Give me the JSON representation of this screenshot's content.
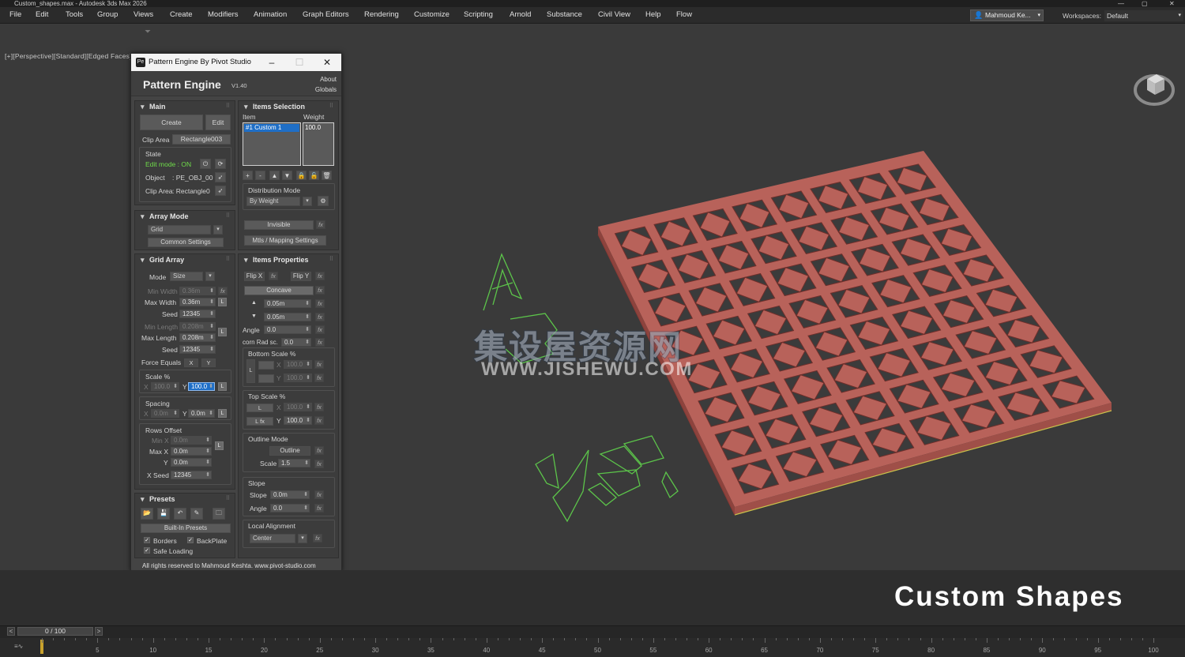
{
  "app": {
    "window_title": "Custom_shapes.max - Autodesk 3ds Max 2026",
    "menus": [
      "File",
      "Edit",
      "Tools",
      "Group",
      "Views",
      "Create",
      "Modifiers",
      "Animation",
      "Graph Editors",
      "Rendering",
      "Customize",
      "Scripting",
      "Arnold",
      "Substance",
      "Civil View",
      "Help",
      "Flow"
    ],
    "user": "Mahmoud Ke...",
    "workspaces_label": "Workspaces:",
    "workspace": "Default",
    "viewport_label": "[+][Perspective][Standard][Edged Faces]",
    "caption": "Custom Shapes",
    "watermark_cn": "集设屋资源网",
    "watermark_url": "WWW.JISHEWU.COM"
  },
  "timeline": {
    "slider": "0 / 100",
    "prev": "<",
    "next": ">",
    "ticks": [
      "5",
      "10",
      "15",
      "20",
      "25",
      "30",
      "35",
      "40",
      "45",
      "50",
      "55",
      "60",
      "65",
      "70",
      "75",
      "80",
      "85",
      "90",
      "95",
      "100"
    ]
  },
  "plugin": {
    "title": "Pattern Engine By Pivot Studio",
    "icon_text": "Pe",
    "name": "Pattern Engine",
    "version": "V1.40",
    "about": "About",
    "globals": "Globals",
    "footer": "All rights reserved to Mahmoud Keshta. www.pivot-studio.com",
    "main": {
      "header": "Main",
      "create": "Create",
      "edit": "Edit",
      "clip_area_label": "Clip Area",
      "clip_area_value": "Rectangle003",
      "state_label": "State",
      "edit_mode": "Edit mode : ON",
      "object_label": "Object",
      "object_value": ": PE_OBJ_00",
      "clip_area2_label": "Clip Area",
      "clip_area2_value": ": Rectangle0"
    },
    "array_mode": {
      "header": "Array Mode",
      "value": "Grid",
      "common_settings": "Common Settings"
    },
    "grid_array": {
      "header": "Grid Array",
      "mode_label": "Mode",
      "mode_value": "Size",
      "min_width_label": "Min Width",
      "min_width": "0.36m",
      "max_width_label": "Max Width",
      "max_width": "0.36m",
      "seed_label": "Seed",
      "seed1": "12345",
      "min_length_label": "Min Length",
      "min_length": "0.208m",
      "max_length_label": "Max Length",
      "max_length": "0.208m",
      "seed2": "12345",
      "force_equals_label": "Force Equals",
      "fx": "X",
      "fy": "Y",
      "scale_label": "Scale %",
      "scale_x_label": "X",
      "scale_x": "100.0",
      "scale_y_label": "Y",
      "scale_y": "100.0",
      "spacing_label": "Spacing",
      "spacing_x_label": "X",
      "spacing_x": "0.0m",
      "spacing_y_label": "Y",
      "spacing_y": "0.0m",
      "rows_offset_label": "Rows Offset",
      "min_x_label": "Min X",
      "min_x": "0.0m",
      "max_x_label": "Max X",
      "max_x": "0.0m",
      "y_label": "Y",
      "y_val": "0.0m",
      "x_seed_label": "X Seed",
      "x_seed": "12345",
      "lock": "L"
    },
    "presets": {
      "header": "Presets",
      "built_in": "Built-In Presets",
      "borders": "Borders",
      "backplate": "BackPlate",
      "safe_loading": "Safe Loading"
    },
    "items_selection": {
      "header": "Items Selection",
      "col_item": "Item",
      "col_weight": "Weight",
      "item1": "#1 Custom 1",
      "weight1": "100.0",
      "distribution_label": "Distribution Mode",
      "distribution_value": "By Weight",
      "invisible": "Invisible",
      "mtls": "Mtls / Mapping Settings"
    },
    "items_properties": {
      "header": "Items Properties",
      "flip_x": "Flip X",
      "flip_y": "Flip Y",
      "fx": "fx",
      "concave": "Concave",
      "up_val": "0.05m",
      "down_val": "0.05m",
      "angle_label": "Angle",
      "angle": "0.0",
      "corn_label": "corn Rad sc.",
      "corn": "0.0",
      "bottom_scale_label": "Bottom Scale %",
      "bs_x": "100.0",
      "bs_y": "100.0",
      "top_scale_label": "Top Scale %",
      "ts_l": "L",
      "ts_lfx": "L fx",
      "ts_x": "100.0",
      "ts_y": "100.0",
      "outline_mode_label": "Outline Mode",
      "outline": "Outline",
      "outline_scale_label": "Scale",
      "outline_scale": "1.5",
      "slope_group": "Slope",
      "slope_label": "Slope",
      "slope": "0.0m",
      "slope_angle_label": "Angle",
      "slope_angle": "0.0",
      "local_alignment_label": "Local Alignment",
      "local_alignment": "Center",
      "x": "X",
      "y": "Y"
    }
  },
  "colors": {
    "tile": "#b8625a",
    "spline": "#5cc44a",
    "selection": "#1f6fc7"
  }
}
